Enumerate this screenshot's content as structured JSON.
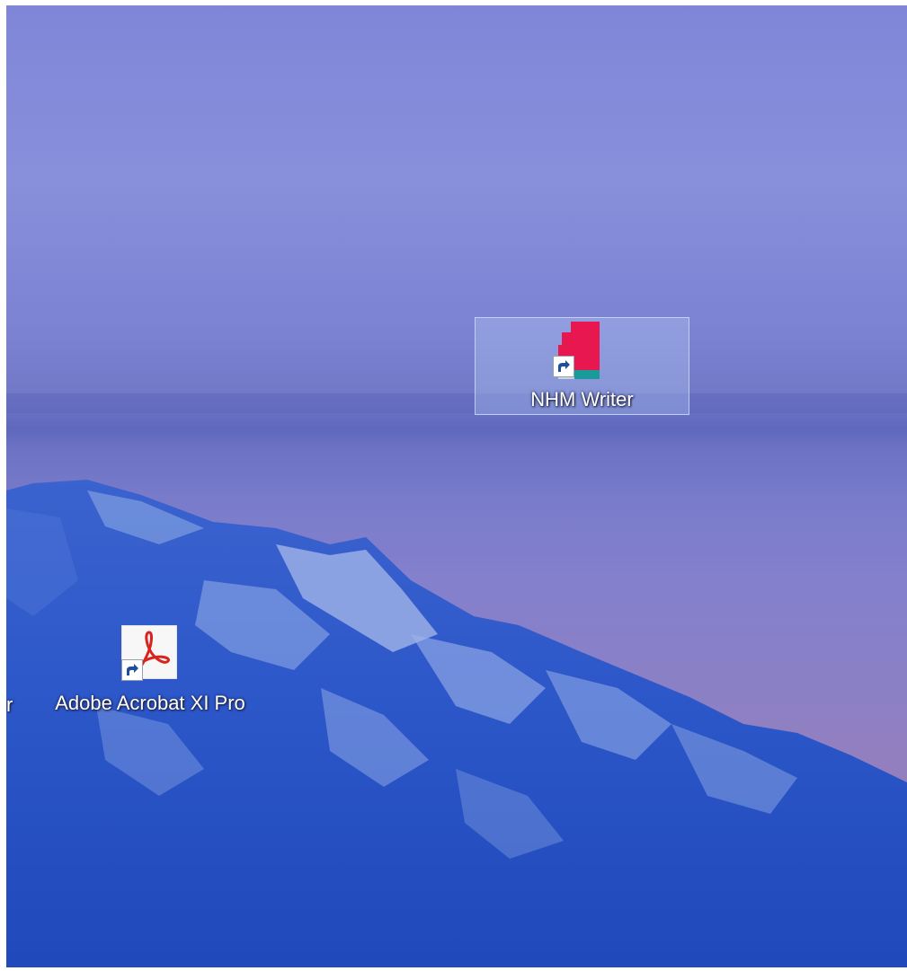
{
  "desktop": {
    "icons": [
      {
        "label": "NHM Writer",
        "icon": "nhm-writer-app-icon",
        "selected": true
      },
      {
        "label": "Adobe Acrobat XI Pro",
        "icon": "adobe-acrobat-icon",
        "selected": false
      }
    ],
    "partial_label": "r",
    "colors": {
      "sky": "#8088d8",
      "horizon": "#5e68bd",
      "mountain": "#2a55c8",
      "snow": "#a8b8e8",
      "nhm_red": "#e8174f",
      "nhm_teal": "#1a9a9a",
      "acrobat_red": "#d9231f"
    }
  }
}
